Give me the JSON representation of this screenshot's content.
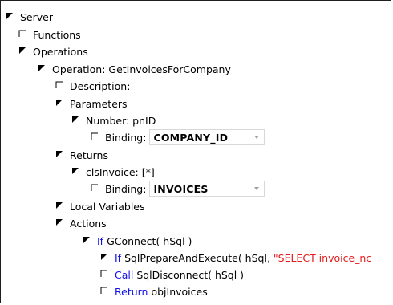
{
  "tree": {
    "server": "Server",
    "functions": "Functions",
    "operations": "Operations",
    "operation_label": "Operation: GetInvoicesForCompany",
    "description": "Description:",
    "parameters": "Parameters",
    "number_param": "Number: pnID",
    "param_binding_label": "Binding:",
    "param_binding_value": "COMPANY_ID",
    "returns": "Returns",
    "return_item": "clsInvoice: [*]",
    "return_binding_label": "Binding:",
    "return_binding_value": "INVOICES",
    "local_variables": "Local Variables",
    "actions": "Actions",
    "action_if_kw": "If",
    "action_if_rest": " GConnect( hSql )",
    "action_sql_kw": "If",
    "action_sql_rest": " SqlPrepareAndExecute( hSql, ",
    "action_sql_string": "\"SELECT invoice_nc",
    "action_call_kw": "Call",
    "action_call_rest": " SqlDisconnect( hSql )",
    "action_return_kw": "Return",
    "action_return_rest": " objInvoices"
  },
  "colors": {
    "keyword": "#1010e8",
    "string": "#e31b1b",
    "text": "#000000"
  },
  "icons": {
    "expanded": "triangle-expanded-icon",
    "collapsed": "corner-collapsed-icon"
  }
}
